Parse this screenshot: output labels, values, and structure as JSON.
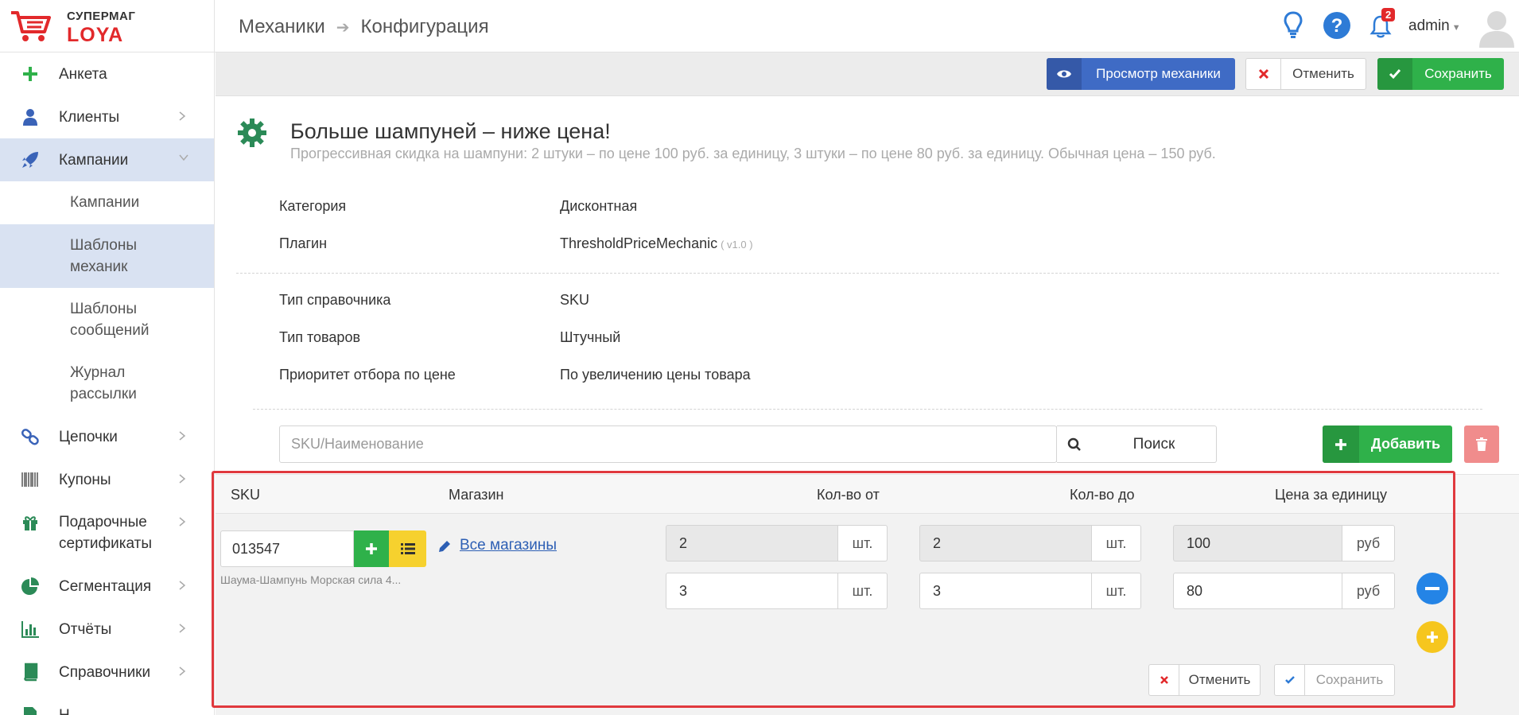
{
  "brand": {
    "name_top": "СУПЕРМАГ",
    "name_bottom": "LOYA",
    "color": "#e2292b"
  },
  "header": {
    "breadcrumb": [
      "Механики",
      "Конфигурация"
    ],
    "notifications_count": "2",
    "user": "admin",
    "icons": [
      "lightbulb-icon",
      "help-icon",
      "bell-icon",
      "avatar"
    ]
  },
  "sidebar": {
    "items": [
      {
        "label": "Анкета",
        "icon": "plus-icon",
        "expandable": false
      },
      {
        "label": "Клиенты",
        "icon": "user-icon",
        "expandable": true
      },
      {
        "label": "Кампании",
        "icon": "rocket-icon",
        "expandable": true,
        "expanded": true,
        "active": true
      },
      {
        "label": "Цепочки",
        "icon": "chain-icon",
        "expandable": true
      },
      {
        "label": "Купоны",
        "icon": "barcode-icon",
        "expandable": true
      },
      {
        "label": "Подарочные сертификаты",
        "icon": "gift-icon",
        "expandable": true
      },
      {
        "label": "Сегментация",
        "icon": "pie-chart-icon",
        "expandable": true
      },
      {
        "label": "Отчёты",
        "icon": "bar-chart-icon",
        "expandable": true
      },
      {
        "label": "Справочники",
        "icon": "book-icon",
        "expandable": true
      },
      {
        "label": "Н...",
        "icon": "document-icon",
        "expandable": true
      }
    ],
    "sub_items": [
      {
        "label": "Кампании",
        "active": false
      },
      {
        "label": "Шаблоны механик",
        "active": true
      },
      {
        "label": "Шаблоны сообщений",
        "active": false
      },
      {
        "label": "Журнал рассылки",
        "active": false
      }
    ]
  },
  "toolbar": {
    "view_label": "Просмотр механики",
    "cancel_label": "Отменить",
    "save_label": "Сохранить"
  },
  "mechanic": {
    "title": "Больше шампуней – ниже цена!",
    "description": "Прогрессивная скидка на шампуни: 2 штуки – по цене 100 руб. за единицу, 3 штуки – по цене 80 руб. за единицу. Обычная цена – 150 руб.",
    "props": [
      {
        "label": "Категория",
        "value": "Дисконтная"
      },
      {
        "label": "Плагин",
        "value": "ThresholdPriceMechanic",
        "version": "( v1.0 )"
      }
    ],
    "props2": [
      {
        "label": "Тип справочника",
        "value": "SKU"
      },
      {
        "label": "Тип товаров",
        "value": "Штучный"
      },
      {
        "label": "Приоритет отбора по цене",
        "value": "По увеличению цены товара"
      }
    ]
  },
  "search": {
    "placeholder": "SKU/Наименование",
    "button": "Поиск",
    "add_label": "Добавить"
  },
  "table": {
    "headers": [
      "SKU",
      "Магазин",
      "Кол-во от",
      "Кол-во до",
      "Цена за единицу"
    ],
    "row": {
      "sku": "013547",
      "product_name": "Шаума-Шампунь Морская сила 4...",
      "store": "Все магазины",
      "tiers": [
        {
          "from": "2",
          "to": "2",
          "price": "100",
          "readonly": true
        },
        {
          "from": "3",
          "to": "3",
          "price": "80",
          "readonly": false
        }
      ],
      "unit_qty": "шт.",
      "unit_price": "руб",
      "cancel_label": "Отменить",
      "save_label": "Сохранить"
    }
  }
}
